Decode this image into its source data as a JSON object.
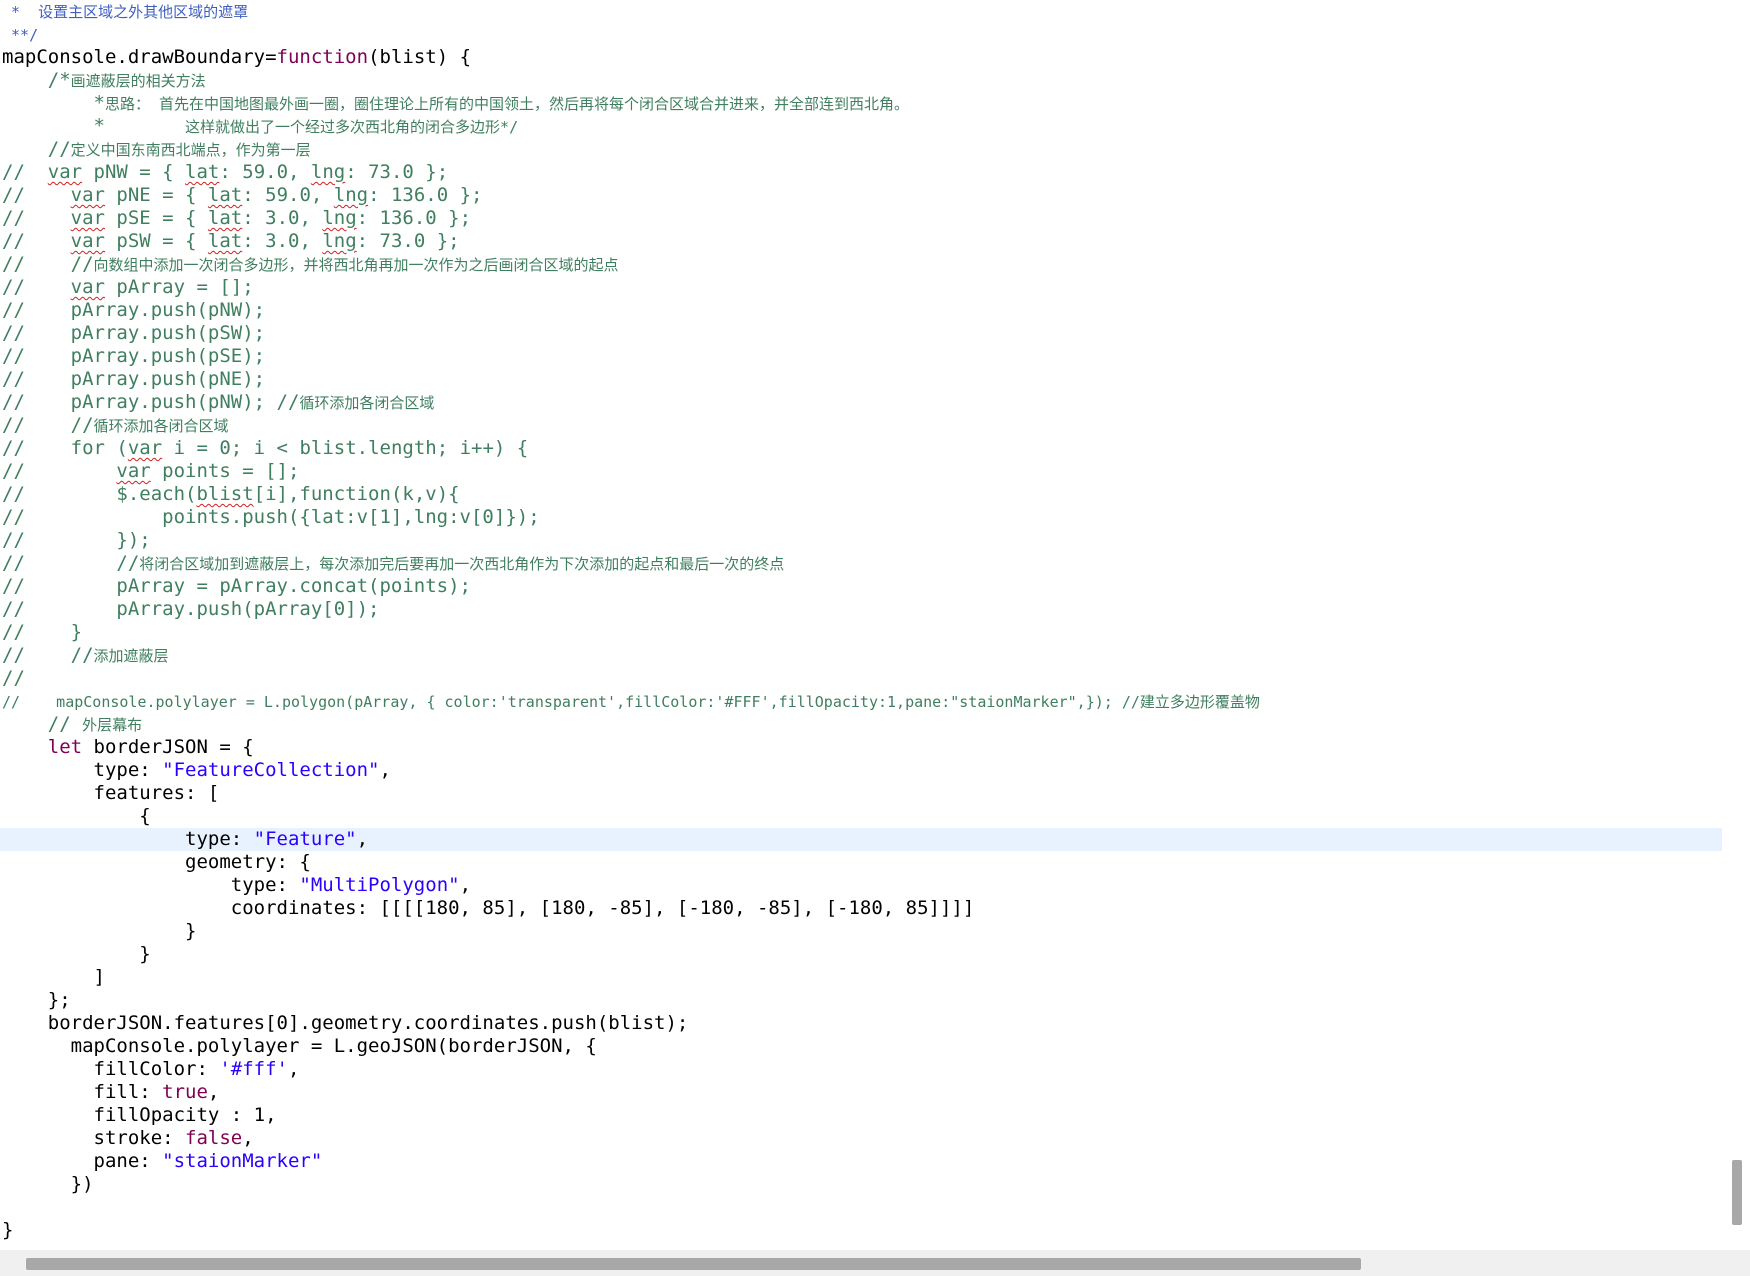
{
  "editor": {
    "lines": [
      {
        "parts": [
          {
            "t": " *  设置主区域之外其他区域的遮罩",
            "c": "doc"
          }
        ]
      },
      {
        "parts": [
          {
            "t": " **/",
            "c": "doc"
          }
        ]
      },
      {
        "parts": [
          {
            "t": "mapConsole.drawBoundary="
          },
          {
            "t": "function",
            "c": "kw"
          },
          {
            "t": "(blist) {"
          }
        ]
      },
      {
        "parts": [
          {
            "t": "    /*",
            "c": "cm"
          },
          {
            "t": "画遮蔽层的相关方法",
            "c": "cm cjk"
          }
        ]
      },
      {
        "parts": [
          {
            "t": "        *",
            "c": "cm"
          },
          {
            "t": "思路： 首先在中国地图最外画一圈，圈住理论上所有的中国领土，然后再将每个闭合区域合并进来，并全部连到西北角。",
            "c": "cm cjk"
          }
        ]
      },
      {
        "parts": [
          {
            "t": "        *       ",
            "c": "cm"
          },
          {
            "t": "这样就做出了一个经过多次西北角的闭合多边形*/",
            "c": "cm cjk"
          }
        ]
      },
      {
        "parts": [
          {
            "t": "    //",
            "c": "cm"
          },
          {
            "t": "定义中国东南西北端点，作为第一层",
            "c": "cm cjk"
          }
        ]
      },
      {
        "parts": [
          {
            "t": "//  ",
            "c": "cm"
          },
          {
            "t": "var",
            "c": "cm squig"
          },
          {
            "t": " pNW = { ",
            "c": "cm"
          },
          {
            "t": "lat",
            "c": "cm squig"
          },
          {
            "t": ": 59.0, ",
            "c": "cm"
          },
          {
            "t": "lng",
            "c": "cm squig"
          },
          {
            "t": ": 73.0 };",
            "c": "cm"
          }
        ]
      },
      {
        "parts": [
          {
            "t": "//    ",
            "c": "cm"
          },
          {
            "t": "var",
            "c": "cm squig"
          },
          {
            "t": " pNE = { ",
            "c": "cm"
          },
          {
            "t": "lat",
            "c": "cm squig"
          },
          {
            "t": ": 59.0, ",
            "c": "cm"
          },
          {
            "t": "lng",
            "c": "cm squig"
          },
          {
            "t": ": 136.0 };",
            "c": "cm"
          }
        ]
      },
      {
        "parts": [
          {
            "t": "//    ",
            "c": "cm"
          },
          {
            "t": "var",
            "c": "cm squig"
          },
          {
            "t": " pSE = { ",
            "c": "cm"
          },
          {
            "t": "lat",
            "c": "cm squig"
          },
          {
            "t": ": 3.0, ",
            "c": "cm"
          },
          {
            "t": "lng",
            "c": "cm squig"
          },
          {
            "t": ": 136.0 };",
            "c": "cm"
          }
        ]
      },
      {
        "parts": [
          {
            "t": "//    ",
            "c": "cm"
          },
          {
            "t": "var",
            "c": "cm squig"
          },
          {
            "t": " pSW = { ",
            "c": "cm"
          },
          {
            "t": "lat",
            "c": "cm squig"
          },
          {
            "t": ": 3.0, ",
            "c": "cm"
          },
          {
            "t": "lng",
            "c": "cm squig"
          },
          {
            "t": ": 73.0 };",
            "c": "cm"
          }
        ]
      },
      {
        "parts": [
          {
            "t": "//    //",
            "c": "cm"
          },
          {
            "t": "向数组中添加一次闭合多边形，并将西北角再加一次作为之后画闭合区域的起点",
            "c": "cm cjk"
          }
        ]
      },
      {
        "parts": [
          {
            "t": "//    ",
            "c": "cm"
          },
          {
            "t": "var",
            "c": "cm squig"
          },
          {
            "t": " pArray = [];",
            "c": "cm"
          }
        ]
      },
      {
        "parts": [
          {
            "t": "//    pArray.push(pNW);",
            "c": "cm"
          }
        ]
      },
      {
        "parts": [
          {
            "t": "//    pArray.push(pSW);",
            "c": "cm"
          }
        ]
      },
      {
        "parts": [
          {
            "t": "//    pArray.push(pSE);",
            "c": "cm"
          }
        ]
      },
      {
        "parts": [
          {
            "t": "//    pArray.push(pNE);",
            "c": "cm"
          }
        ]
      },
      {
        "parts": [
          {
            "t": "//    pArray.push(pNW); //",
            "c": "cm"
          },
          {
            "t": "循环添加各闭合区域",
            "c": "cm cjk"
          }
        ]
      },
      {
        "parts": [
          {
            "t": "//    //",
            "c": "cm"
          },
          {
            "t": "循环添加各闭合区域",
            "c": "cm cjk"
          }
        ]
      },
      {
        "parts": [
          {
            "t": "//    for (",
            "c": "cm"
          },
          {
            "t": "var",
            "c": "cm squig"
          },
          {
            "t": " i = 0; i < blist.length; i++) {",
            "c": "cm"
          }
        ]
      },
      {
        "parts": [
          {
            "t": "//        ",
            "c": "cm"
          },
          {
            "t": "var",
            "c": "cm squig"
          },
          {
            "t": " points = [];",
            "c": "cm"
          }
        ]
      },
      {
        "parts": [
          {
            "t": "//        $.each(",
            "c": "cm"
          },
          {
            "t": "blist",
            "c": "cm squig"
          },
          {
            "t": "[i],function(k,v){",
            "c": "cm"
          }
        ]
      },
      {
        "parts": [
          {
            "t": "//            points.push({lat:v[1],lng:v[0]});",
            "c": "cm"
          }
        ]
      },
      {
        "parts": [
          {
            "t": "//        });",
            "c": "cm"
          }
        ]
      },
      {
        "parts": [
          {
            "t": "//        //",
            "c": "cm"
          },
          {
            "t": "将闭合区域加到遮蔽层上，每次添加完后要再加一次西北角作为下次添加的起点和最后一次的终点",
            "c": "cm cjk"
          }
        ]
      },
      {
        "parts": [
          {
            "t": "//        pArray = pArray.concat(points);",
            "c": "cm"
          }
        ]
      },
      {
        "parts": [
          {
            "t": "//        pArray.push(pArray[0]);",
            "c": "cm"
          }
        ]
      },
      {
        "parts": [
          {
            "t": "//    }",
            "c": "cm"
          }
        ]
      },
      {
        "parts": [
          {
            "t": "//    //",
            "c": "cm"
          },
          {
            "t": "添加遮蔽层",
            "c": "cm cjk"
          }
        ]
      },
      {
        "parts": [
          {
            "t": "//",
            "c": "cm"
          }
        ]
      },
      {
        "parts": [
          {
            "t": "//    mapConsole.polylayer = L.polygon(pArray, { color:'transparent',fillColor:'#FFF',fillOpacity:1,pane:\"staionMarker\",}); //",
            "c": "cm small"
          },
          {
            "t": "建立多边形覆盖物",
            "c": "cm cjk"
          }
        ]
      },
      {
        "parts": [
          {
            "t": "    // ",
            "c": "cm"
          },
          {
            "t": "外层幕布",
            "c": "cm cjk"
          }
        ]
      },
      {
        "parts": [
          {
            "t": "    "
          },
          {
            "t": "let",
            "c": "kw"
          },
          {
            "t": " borderJSON = {"
          }
        ]
      },
      {
        "parts": [
          {
            "t": "        type: "
          },
          {
            "t": "\"FeatureCollection\"",
            "c": "str"
          },
          {
            "t": ","
          }
        ]
      },
      {
        "parts": [
          {
            "t": "        features: ["
          }
        ]
      },
      {
        "parts": [
          {
            "t": "            {"
          }
        ]
      },
      {
        "current": true,
        "parts": [
          {
            "t": "                type: "
          },
          {
            "t": "\"Feature\"",
            "c": "str"
          },
          {
            "t": ","
          }
        ]
      },
      {
        "parts": [
          {
            "t": "                geometry: {"
          }
        ]
      },
      {
        "parts": [
          {
            "t": "                    type: "
          },
          {
            "t": "\"MultiPolygon\"",
            "c": "str"
          },
          {
            "t": ","
          }
        ]
      },
      {
        "parts": [
          {
            "t": "                    coordinates: [[[[180, 85], [180, -85], [-180, -85], [-180, 85]]]]"
          }
        ]
      },
      {
        "parts": [
          {
            "t": "                }"
          }
        ]
      },
      {
        "parts": [
          {
            "t": "            }"
          }
        ]
      },
      {
        "parts": [
          {
            "t": "        ]"
          }
        ]
      },
      {
        "parts": [
          {
            "t": "    };"
          }
        ]
      },
      {
        "parts": [
          {
            "t": "    borderJSON.features[0].geometry.coordinates.push(blist);"
          }
        ]
      },
      {
        "parts": [
          {
            "t": "      mapConsole.polylayer = L.geoJSON(borderJSON, {"
          }
        ]
      },
      {
        "parts": [
          {
            "t": "        fillColor: "
          },
          {
            "t": "'#fff'",
            "c": "str"
          },
          {
            "t": ","
          }
        ]
      },
      {
        "parts": [
          {
            "t": "        fill: "
          },
          {
            "t": "true",
            "c": "kw"
          },
          {
            "t": ","
          }
        ]
      },
      {
        "parts": [
          {
            "t": "        fillOpacity : 1,"
          }
        ]
      },
      {
        "parts": [
          {
            "t": "        stroke: "
          },
          {
            "t": "false",
            "c": "kw"
          },
          {
            "t": ","
          }
        ]
      },
      {
        "parts": [
          {
            "t": "        pane: "
          },
          {
            "t": "\"staionMarker\"",
            "c": "str"
          }
        ]
      },
      {
        "parts": [
          {
            "t": "      })"
          }
        ]
      },
      {
        "parts": [
          {
            "t": ""
          }
        ]
      },
      {
        "parts": [
          {
            "t": "}"
          }
        ]
      }
    ]
  }
}
